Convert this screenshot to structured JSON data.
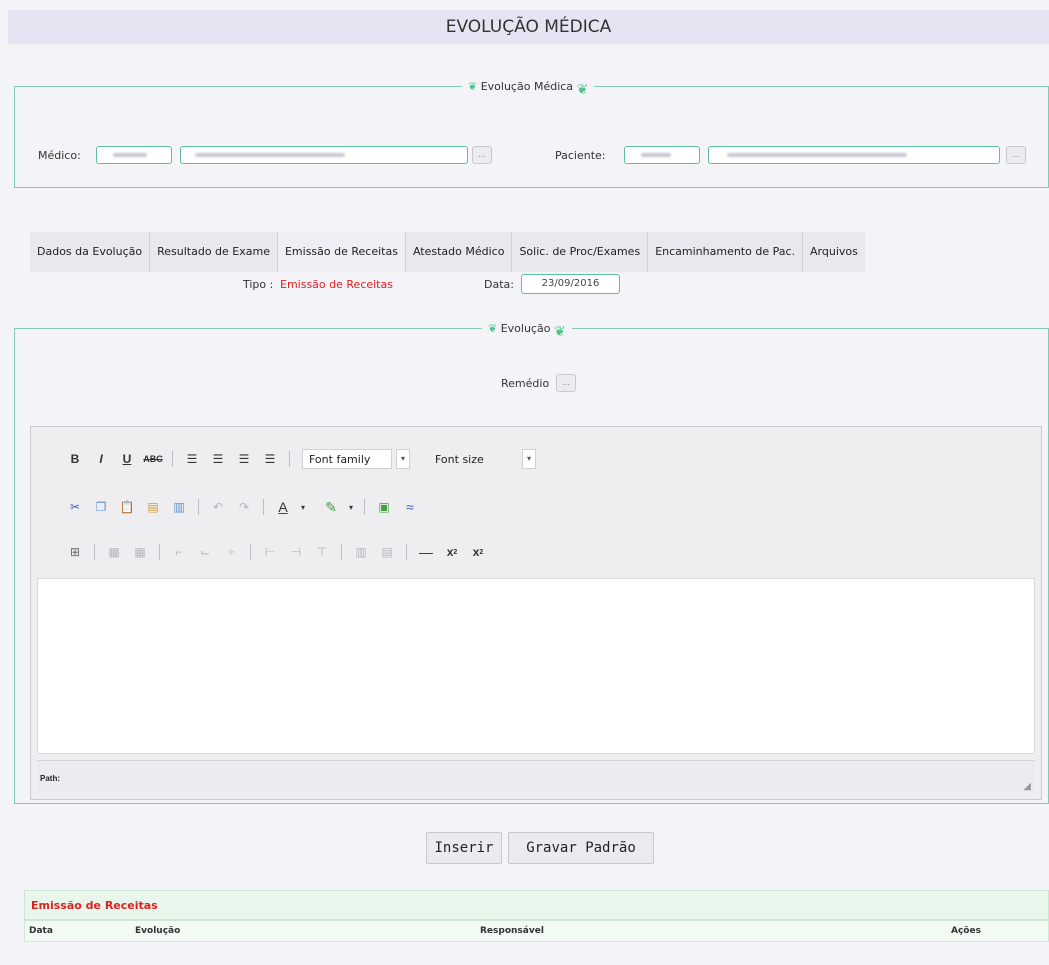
{
  "header": {
    "title": "EVOLUÇÃO MÉDICA"
  },
  "fieldset_top": {
    "legend": "Evolução Médica",
    "medico_label": "Médico:",
    "paciente_label": "Paciente:",
    "lookup_label": "..."
  },
  "tabs": [
    {
      "label": "Dados da Evolução"
    },
    {
      "label": "Resultado de Exame"
    },
    {
      "label": "Emissão de Receitas"
    },
    {
      "label": "Atestado Médico"
    },
    {
      "label": "Solic. de Proc/Exames"
    },
    {
      "label": "Encaminhamento de Pac."
    },
    {
      "label": "Arquivos"
    }
  ],
  "tipo": {
    "label": "Tipo :",
    "value": "Emissão de Receitas"
  },
  "data": {
    "label": "Data:",
    "value": "23/09/2016"
  },
  "fieldset_evolucao": {
    "legend": "Evolução",
    "remedio_label": "Remédio",
    "lookup_label": "..."
  },
  "editor": {
    "font_family": "Font family",
    "font_size": "Font size",
    "path_label": "Path:"
  },
  "buttons": {
    "inserir": "Inserir",
    "gravar": "Gravar Padrão"
  },
  "grid": {
    "title": "Emissão de Receitas",
    "columns": [
      "Data",
      "Evolução",
      "Responsável",
      "Ações"
    ]
  },
  "colors": {
    "accent_border": "#7fcbb4",
    "red": "#e02020",
    "header_bg": "#e4e4f2"
  }
}
